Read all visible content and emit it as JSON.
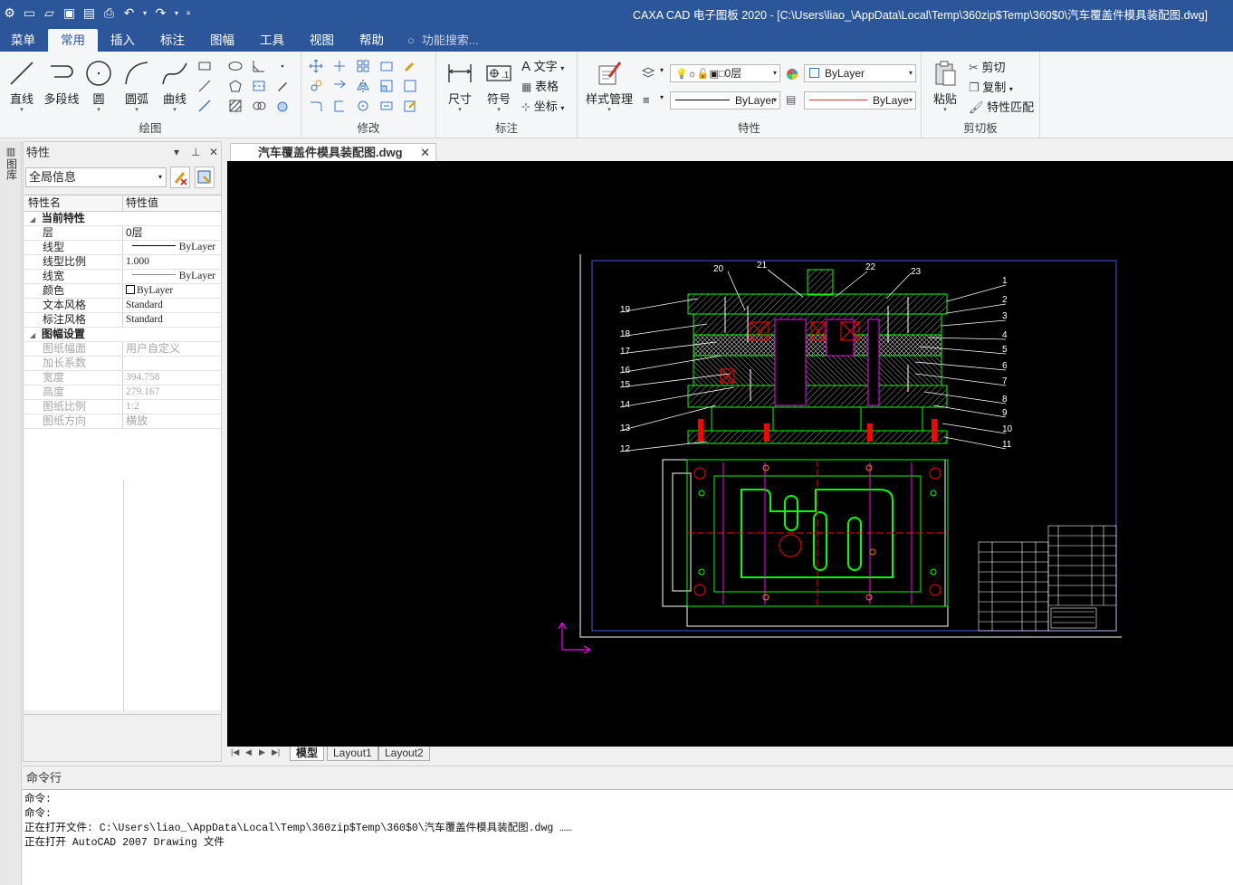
{
  "window": {
    "title": "CAXA CAD 电子图板 2020 - [C:\\Users\\liao_\\AppData\\Local\\Temp\\360zip$Temp\\360$0\\汽车覆盖件模具装配图.dwg]"
  },
  "menu": {
    "items": [
      "菜单",
      "常用",
      "插入",
      "标注",
      "图幅",
      "工具",
      "视图",
      "帮助"
    ],
    "active": "常用",
    "search_placeholder": "功能搜索..."
  },
  "ribbon": {
    "draw": {
      "label": "绘图",
      "line": "直线",
      "polyline": "多段线",
      "circle": "圆",
      "arc": "圆弧",
      "curve": "曲线"
    },
    "modify": {
      "label": "修改"
    },
    "annotate": {
      "label": "标注",
      "dimension": "尺寸",
      "symbol": "符号",
      "text": "文字",
      "table": "表格",
      "coordinate": "坐标"
    },
    "properties": {
      "label": "特性",
      "style_manager": "样式管理",
      "layer_value": "0层",
      "color_value": "ByLayer",
      "linetype_value": "ByLayer",
      "lineweight_value": "ByLaye"
    },
    "clipboard": {
      "label": "剪切板",
      "paste": "粘贴",
      "cut": "剪切",
      "copy": "复制",
      "match": "特性匹配"
    }
  },
  "side_strip": {
    "label": "图库"
  },
  "properties_panel": {
    "title": "特性",
    "filter": "全局信息",
    "col_name": "特性名",
    "col_value": "特性值",
    "section1": "当前特性",
    "rows1": [
      {
        "k": "层",
        "v": "0层"
      },
      {
        "k": "线型",
        "v": "ByLayer"
      },
      {
        "k": "线型比例",
        "v": "1.000"
      },
      {
        "k": "线宽",
        "v": "ByLayer"
      },
      {
        "k": "颜色",
        "v": "ByLayer"
      },
      {
        "k": "文本风格",
        "v": "Standard"
      },
      {
        "k": "标注风格",
        "v": "Standard"
      }
    ],
    "section2": "图幅设置",
    "rows2": [
      {
        "k": "图纸幅面",
        "v": "用户自定义"
      },
      {
        "k": "加长系数",
        "v": ""
      },
      {
        "k": "宽度",
        "v": "394.758"
      },
      {
        "k": "高度",
        "v": "279.167"
      },
      {
        "k": "图纸比例",
        "v": "1:2"
      },
      {
        "k": "图纸方向",
        "v": "横放"
      }
    ]
  },
  "document": {
    "tab": "汽车覆盖件模具装配图.dwg"
  },
  "drawing": {
    "callouts_top": [
      "20",
      "21",
      "22",
      "23"
    ],
    "callouts_left": [
      "19",
      "18",
      "17",
      "16",
      "15",
      "14",
      "13",
      "12"
    ],
    "callouts_right": [
      "1",
      "2",
      "3",
      "4",
      "5",
      "6",
      "7",
      "8",
      "9",
      "10",
      "11"
    ],
    "colors": {
      "background": "#000000",
      "frame": "#3b4fd6",
      "part": "#00ff00",
      "center": "#ff0000",
      "hatch": "#c0c0c0",
      "accent": "#ff00ff"
    }
  },
  "layout_tabs": [
    "模型",
    "Layout1",
    "Layout2"
  ],
  "command": {
    "header": "命令行",
    "lines": [
      "命令:",
      "命令:",
      "正在打开文件: C:\\Users\\liao_\\AppData\\Local\\Temp\\360zip$Temp\\360$0\\汽车覆盖件模具装配图.dwg ……",
      "正在打开 AutoCAD 2007 Drawing 文件"
    ]
  },
  "theme": {
    "accent": "#2b579a"
  }
}
